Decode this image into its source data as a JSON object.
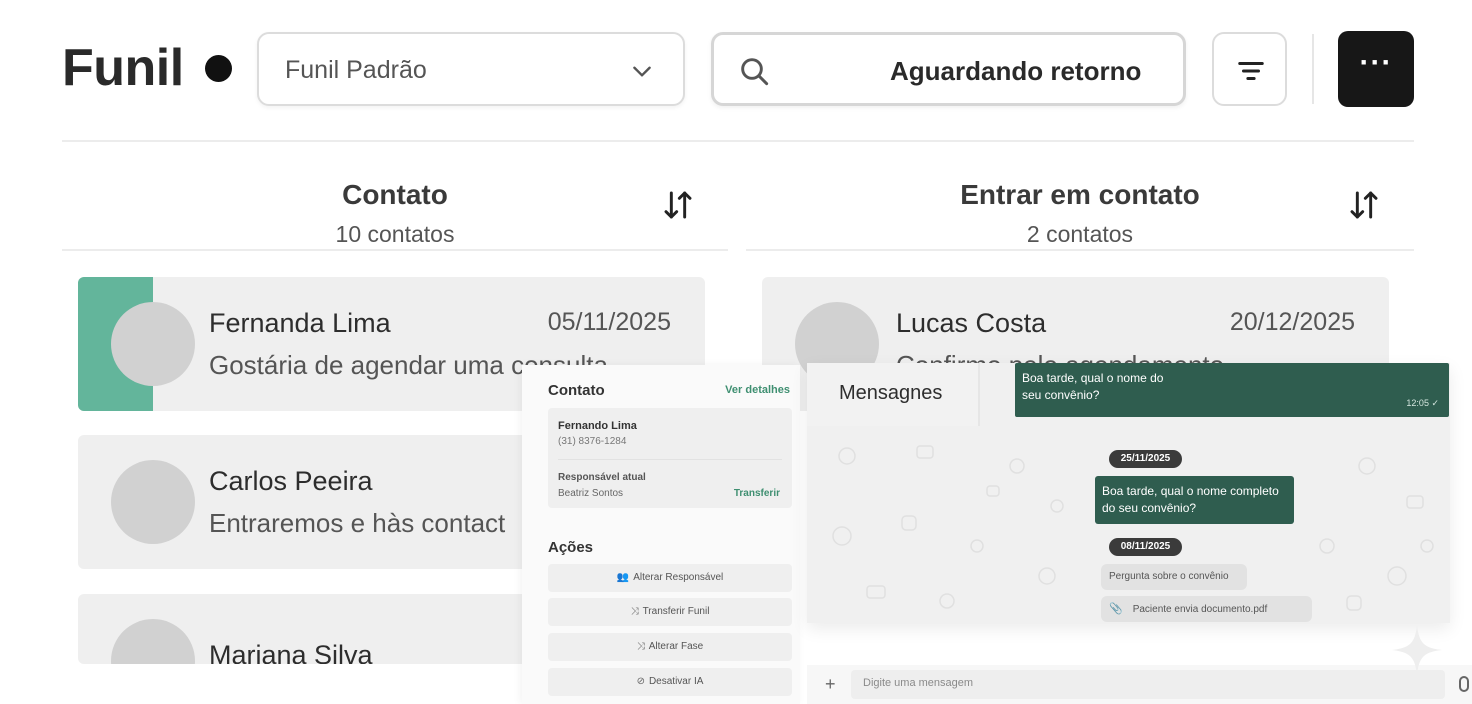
{
  "header": {
    "title": "Funil",
    "funnel_select": "Funil Padrão",
    "search_value": "Aguardando retorno",
    "more_label": "···"
  },
  "columns": [
    {
      "title": "Contato",
      "count": "10 contatos",
      "cards": [
        {
          "name": "Fernanda Lima",
          "date": "05/11/2025",
          "message": "Gostária de agendar uma consulta",
          "active": true
        },
        {
          "name": "Carlos Peeira",
          "date": "",
          "message": "Entraremos e hàs contact"
        },
        {
          "name": "Mariana Silva",
          "date": "",
          "message": ""
        }
      ]
    },
    {
      "title": "Entrar em contato",
      "count": "2 contatos",
      "cards": [
        {
          "name": "Lucas Costa",
          "date": "20/12/2025",
          "message": "Confirmo pelo agendamento"
        }
      ]
    }
  ],
  "contact_panel": {
    "title": "Contato",
    "details_link": "Ver detalhes",
    "contact_name": "Fernando Lima",
    "contact_phone": "(31) 8376-1284",
    "responsible_label": "Responsável atual",
    "responsible_value": "Beatriz Sontos",
    "transfer_link": "Transferir",
    "actions_title": "Ações",
    "actions": [
      {
        "label": "Alterar Responsável",
        "icon": "users-icon"
      },
      {
        "label": "Transferir Funil",
        "icon": "shuffle-icon"
      },
      {
        "label": "Alterar Fase",
        "icon": "shuffle-icon"
      },
      {
        "label": "Desativar IA",
        "icon": "bot-off-icon"
      }
    ]
  },
  "messages": {
    "tab_label": "Mensagnes",
    "bubble_top": "Boa tarde, qual o nome do seu convênio?",
    "bubble_top_time": "12:05 ✓",
    "date_1": "25/11/2025",
    "bubble_mid": "Boa tarde, qual o nome completo do seu convênio?",
    "date_2": "08/11/2025",
    "gray_1": "Pergunta sobre o convênio",
    "gray_2": "Paciente envia documento.pdf",
    "compose_placeholder": "Digite uma mensagem"
  },
  "colors": {
    "accent": "#63b59b",
    "bubble": "#2f5d4f",
    "dark_button": "#171717"
  }
}
